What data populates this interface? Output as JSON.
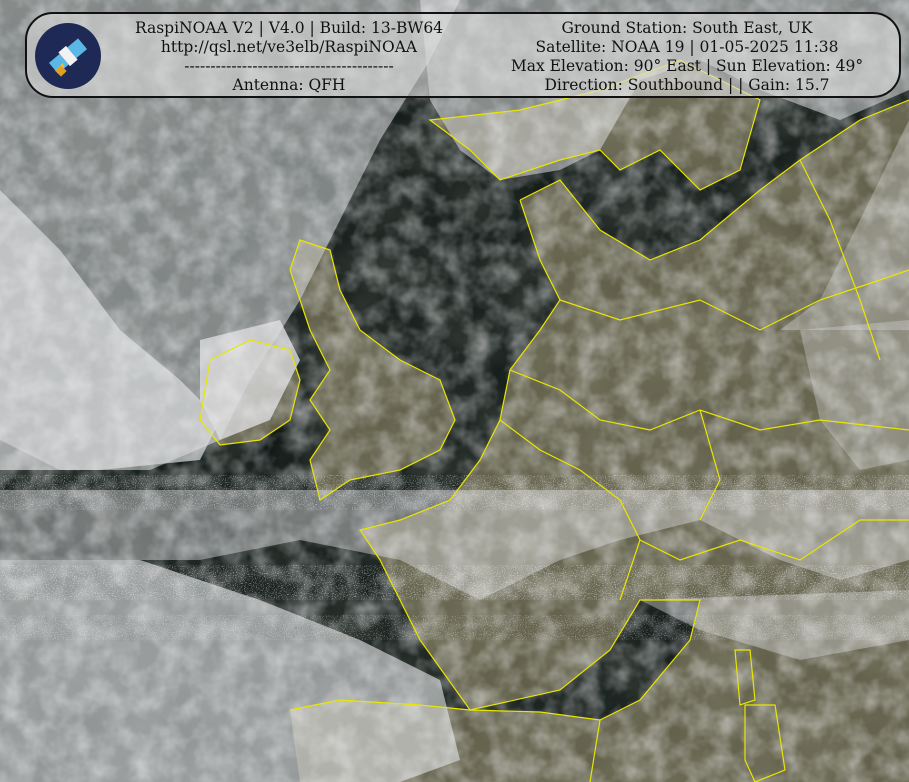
{
  "header": {
    "left_lines": [
      "RaspiNOAA V2 | V4.0 | Build: 13-BW64",
      "http://qsl.net/ve3elb/RaspiNOAA",
      "----------------------------------------",
      "Antenna: QFH"
    ],
    "right_lines": [
      "Ground Station: South East, UK",
      "Satellite: NOAA 19 | 01-05-2025 11:38",
      "Max Elevation: 90° East | Sun Elevation: 49°",
      "Direction: Southbound | | Gain: 15.7"
    ]
  },
  "colors": {
    "sea": "#07100f",
    "land": "#5c5a44",
    "cloud": "#d9dadc",
    "border_lines": "#e8e600",
    "header_bg": "#dcdcdc"
  },
  "logo_icon": "satellite-icon"
}
